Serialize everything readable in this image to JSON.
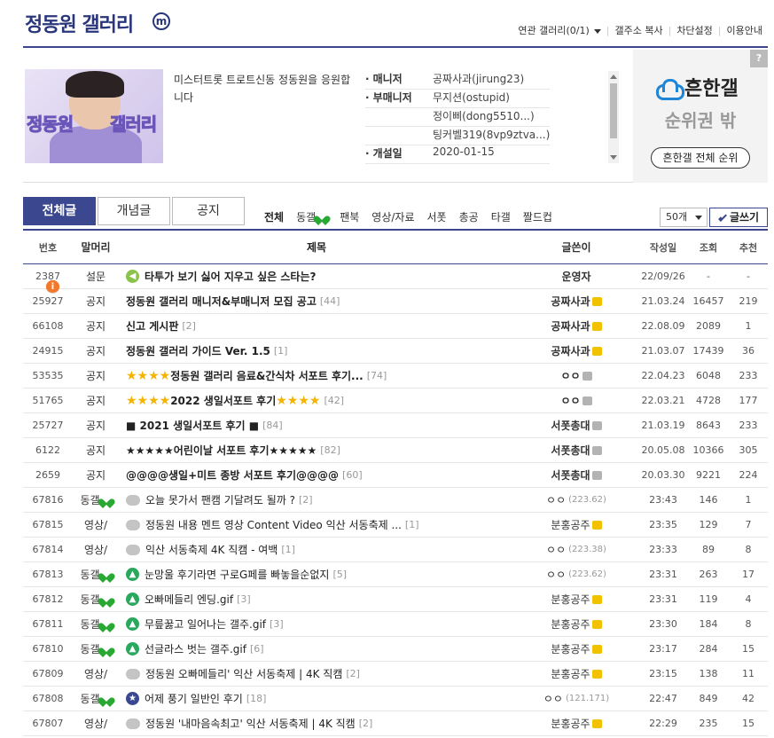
{
  "header": {
    "title": "정동원 갤러리",
    "mini_badge": "m",
    "links": [
      "연관 갤러리(0/1)",
      "갤주소 복사",
      "차단설정",
      "이용안내"
    ]
  },
  "info": {
    "description": "미스터트롯 트로트신동 정동원을 응원합니다",
    "thumb_text_1": "정동원",
    "thumb_text_2": "갤러리",
    "manager_label": "매니저",
    "manager": "공짜사과(jirung23)",
    "submanager_label": "부매니저",
    "submanagers": [
      "무지션(ostupid)",
      "정이삐(dong5510...)",
      "팅커벨319(8vp9ztva...)"
    ],
    "founded_label": "개설일",
    "founded": "2020-01-15"
  },
  "ad": {
    "question": "?",
    "brand": "흔한갤",
    "sub": "순위권 밖",
    "button": "흔한갤 전체 순위"
  },
  "tabs": [
    "전체글",
    "개념글",
    "공지"
  ],
  "heads": [
    "전체",
    "동갤",
    "팬북",
    "영상/자료",
    "서폿",
    "총공",
    "타갤",
    "짤드컵"
  ],
  "per_page": "50개",
  "write": "글쓰기",
  "columns": [
    "번호",
    "말머리",
    "제목",
    "글쓴이",
    "작성일",
    "조회",
    "추천"
  ],
  "rows": [
    {
      "no": "2387",
      "head": "설문",
      "title": "타투가 보기 싫어 지우고 싶은 스타는?",
      "cnt": "",
      "writer": "운영자",
      "ip": "",
      "date": "22/09/26",
      "view": "-",
      "rec": "-"
    },
    {
      "no": "25927",
      "head": "공지",
      "title": "정동원 갤러리 매니저&부매니저 모집 공고",
      "cnt": "[44]",
      "writer": "공짜사과",
      "ip": "",
      "date": "21.03.24",
      "view": "16457",
      "rec": "219"
    },
    {
      "no": "66108",
      "head": "공지",
      "title": "신고 게시판",
      "cnt": "[2]",
      "writer": "공짜사과",
      "ip": "",
      "date": "22.08.09",
      "view": "2089",
      "rec": "1"
    },
    {
      "no": "24915",
      "head": "공지",
      "title": "정동원 갤러리 가이드 Ver. 1.5",
      "cnt": "[1]",
      "writer": "공짜사과",
      "ip": "",
      "date": "21.03.07",
      "view": "17439",
      "rec": "36"
    },
    {
      "no": "53535",
      "head": "공지",
      "title": "정동원 갤러리 음료&간식차 서포트 후기...",
      "cnt": "[74]",
      "writer": "ㅇㅇ",
      "ip": "",
      "date": "22.04.23",
      "view": "6048",
      "rec": "233"
    },
    {
      "no": "51765",
      "head": "공지",
      "title": "2022 생일서포트 후기",
      "cnt": "[42]",
      "writer": "ㅇㅇ",
      "ip": "",
      "date": "22.03.21",
      "view": "4728",
      "rec": "177"
    },
    {
      "no": "25727",
      "head": "공지",
      "title": "■ 2021 생일서포트 후기 ■",
      "cnt": "[84]",
      "writer": "서폿총대",
      "ip": "",
      "date": "21.03.19",
      "view": "8643",
      "rec": "233"
    },
    {
      "no": "6122",
      "head": "공지",
      "title": "★★★★★어린이날 서포트 후기★★★★★",
      "cnt": "[82]",
      "writer": "서폿총대",
      "ip": "",
      "date": "20.05.08",
      "view": "10366",
      "rec": "305"
    },
    {
      "no": "2659",
      "head": "공지",
      "title": "@@@@생일+미트 종방 서포트 후기@@@@",
      "cnt": "[60]",
      "writer": "서폿총대",
      "ip": "",
      "date": "20.03.30",
      "view": "9221",
      "rec": "224"
    },
    {
      "no": "67816",
      "head": "동갤",
      "title": "오늘 못가서 팬캠 기달려도 될까 ?",
      "cnt": "[2]",
      "writer": "ㅇㅇ",
      "ip": "(223.62)",
      "date": "23:43",
      "view": "146",
      "rec": "1"
    },
    {
      "no": "67815",
      "head": "영상/",
      "title": "정동원 내용 멘트 영상 Content Video 익산 서동축제 ...",
      "cnt": "[1]",
      "writer": "분홍공주",
      "ip": "",
      "date": "23:35",
      "view": "129",
      "rec": "7"
    },
    {
      "no": "67814",
      "head": "영상/",
      "title": "익산 서동축제 4K 직캠 - 여백",
      "cnt": "[1]",
      "writer": "ㅇㅇ",
      "ip": "(223.38)",
      "date": "23:33",
      "view": "89",
      "rec": "8"
    },
    {
      "no": "67813",
      "head": "동갤",
      "title": "눈망울 후기라면 구로G페를 빠놓을순없지",
      "cnt": "[5]",
      "writer": "ㅇㅇ",
      "ip": "(223.62)",
      "date": "23:31",
      "view": "263",
      "rec": "17"
    },
    {
      "no": "67812",
      "head": "동갤",
      "title": "오빠메들리 엔딩.gif",
      "cnt": "[3]",
      "writer": "분홍공주",
      "ip": "",
      "date": "23:31",
      "view": "119",
      "rec": "4"
    },
    {
      "no": "67811",
      "head": "동갤",
      "title": "무릎꿇고 일어나는 갤주.gif",
      "cnt": "[3]",
      "writer": "분홍공주",
      "ip": "",
      "date": "23:30",
      "view": "184",
      "rec": "8"
    },
    {
      "no": "67810",
      "head": "동갤",
      "title": "선글라스 벗는 갤주.gif",
      "cnt": "[6]",
      "writer": "분홍공주",
      "ip": "",
      "date": "23:17",
      "view": "284",
      "rec": "15"
    },
    {
      "no": "67809",
      "head": "영상/",
      "title": "정동원 오빠메들리' 익산 서동축제 | 4K 직캠",
      "cnt": "[2]",
      "writer": "분홍공주",
      "ip": "",
      "date": "23:15",
      "view": "138",
      "rec": "11"
    },
    {
      "no": "67808",
      "head": "동갤",
      "title": "어제 풍기 일반인 후기",
      "cnt": "[18]",
      "writer": "ㅇㅇ",
      "ip": "(121.171)",
      "date": "22:47",
      "view": "849",
      "rec": "42"
    },
    {
      "no": "67807",
      "head": "영상/",
      "title": "정동원 '내마음속최고' 익산 서동축제 | 4K 직캠",
      "cnt": "[2]",
      "writer": "분홍공주",
      "ip": "",
      "date": "22:29",
      "view": "235",
      "rec": "15"
    }
  ]
}
